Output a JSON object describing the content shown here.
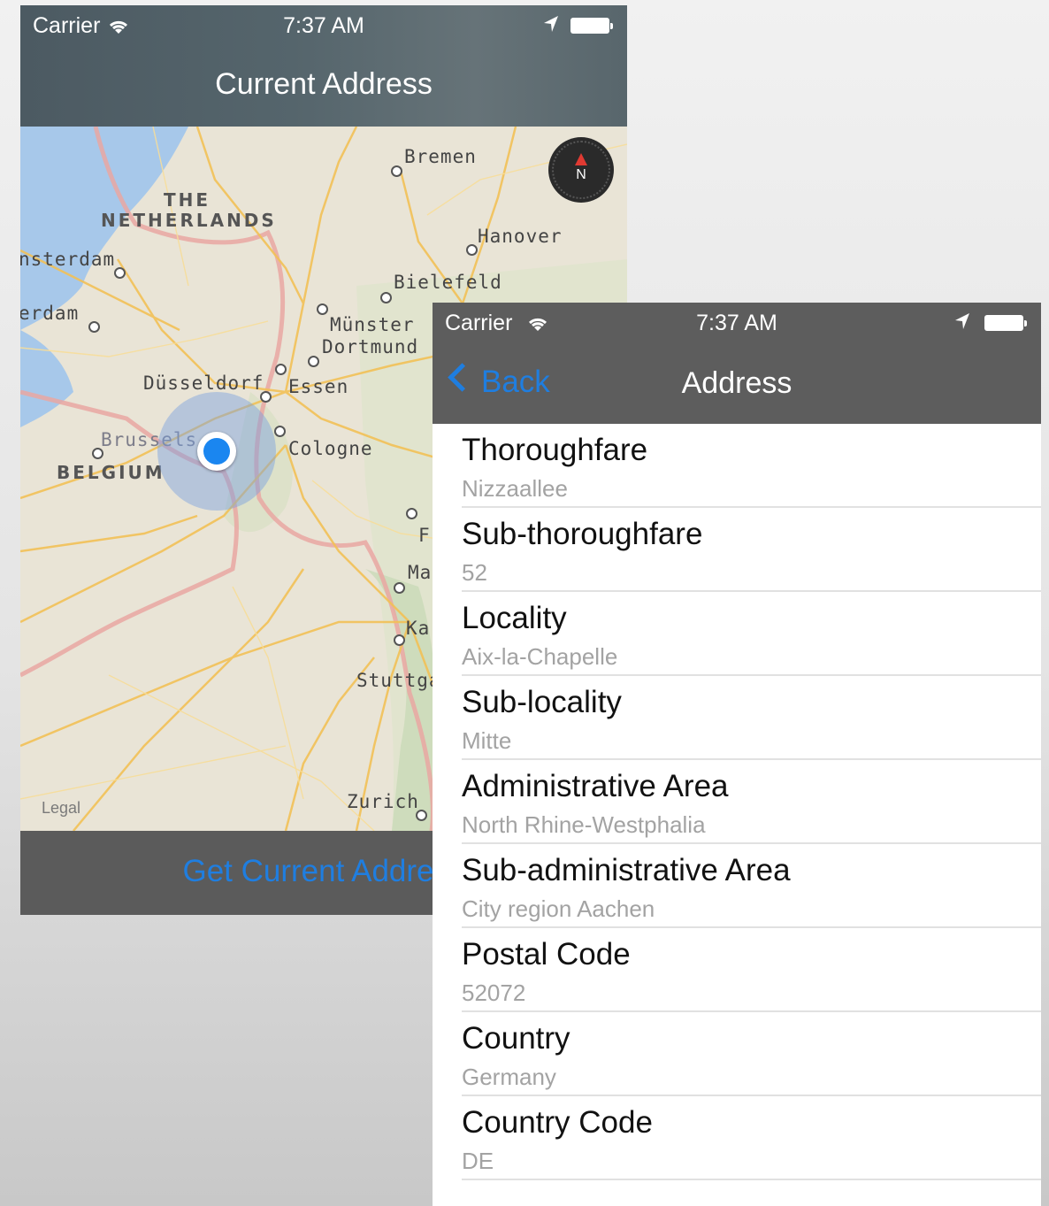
{
  "status_bar": {
    "carrier": "Carrier",
    "time": "7:37 AM"
  },
  "map_screen": {
    "title": "Current Address",
    "legal": "Legal",
    "compass_label": "N",
    "button_label": "Get Current Address",
    "map_labels": {
      "cities": [
        "Bremen",
        "Hanover",
        "Bielefeld",
        "nsterdam",
        "erdam",
        "Münster",
        "Dortmund",
        "Düsseldorf",
        "Essen",
        "Brussels",
        "Cologne",
        "Stuttga",
        "Zurich",
        "F",
        "Ma",
        "Ka"
      ],
      "countries": [
        "THE",
        "NETHERLANDS",
        "BELGIUM"
      ]
    }
  },
  "address_screen": {
    "back_label": "Back",
    "title": "Address",
    "rows": [
      {
        "label": "Thoroughfare",
        "value": "Nizzaallee"
      },
      {
        "label": "Sub-thoroughfare",
        "value": "52"
      },
      {
        "label": "Locality",
        "value": "Aix-la-Chapelle"
      },
      {
        "label": "Sub-locality",
        "value": "Mitte"
      },
      {
        "label": "Administrative Area",
        "value": "North Rhine-Westphalia"
      },
      {
        "label": "Sub-administrative Area",
        "value": "City region Aachen"
      },
      {
        "label": "Postal Code",
        "value": "52072"
      },
      {
        "label": "Country",
        "value": "Germany"
      },
      {
        "label": "Country Code",
        "value": "DE"
      }
    ]
  },
  "colors": {
    "tint": "#1f7ee0",
    "nav_bar": "#5d5d5d",
    "user_location": "#1a86f0"
  },
  "icons": [
    "wifi-icon",
    "location-arrow-icon",
    "battery-icon",
    "compass-icon",
    "back-chevron-icon"
  ]
}
